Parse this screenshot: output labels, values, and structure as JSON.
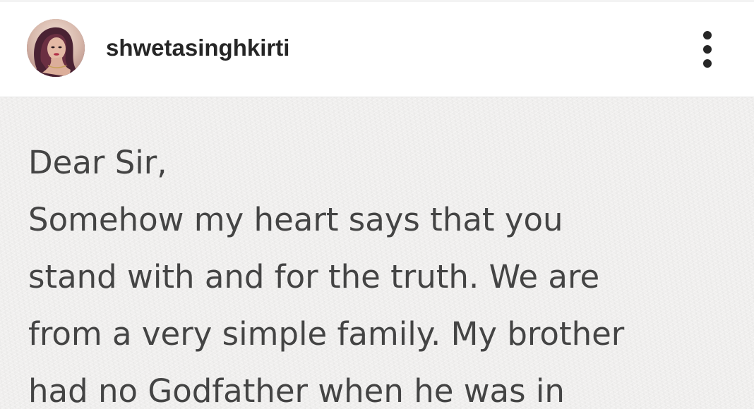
{
  "post": {
    "username": "shwetasinghkirti",
    "avatar_icon": "profile-photo",
    "more_icon": "more-options-vertical-icon",
    "letter_lines": [
      "Dear Sir,",
      "Somehow my heart says that you",
      "stand with and for the truth. We are",
      "from a very simple family. My brother",
      "had no Godfather when he was in"
    ]
  },
  "colors": {
    "header_bg": "#ffffff",
    "username_text": "#262626",
    "paper_bg": "#f1f0ef",
    "letter_text": "#444444"
  }
}
